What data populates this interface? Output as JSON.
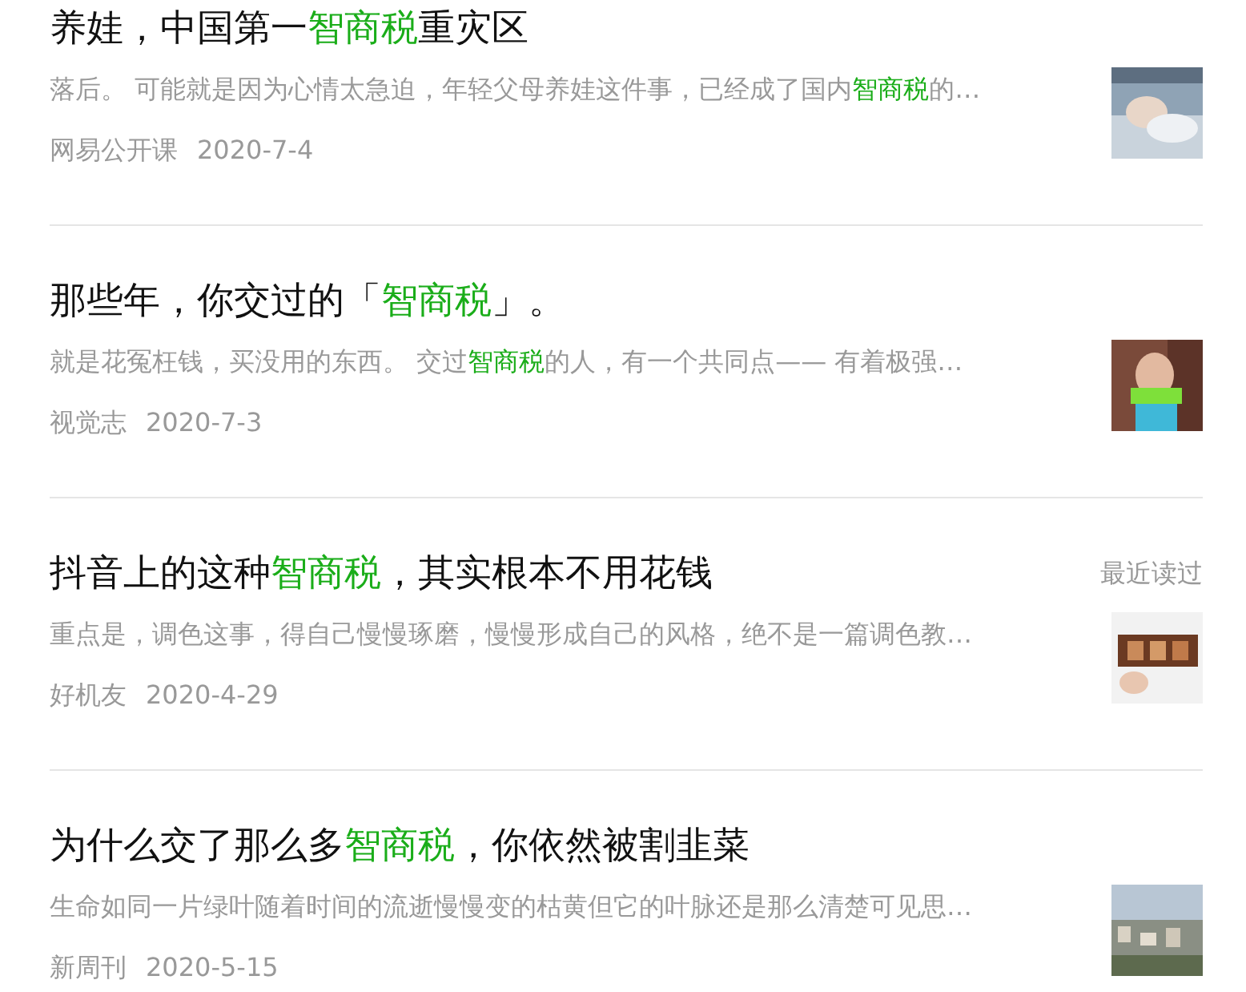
{
  "articles": [
    {
      "title": [
        {
          "text": "养娃，中国第一",
          "highlight": false
        },
        {
          "text": "智商税",
          "highlight": true
        },
        {
          "text": "重灾区",
          "highlight": false
        }
      ],
      "snippet": [
        {
          "text": "落后。 可能就是因为心情太急迫，年轻父母养娃这件事，已经成了国内",
          "highlight": false
        },
        {
          "text": "智商税",
          "highlight": true
        },
        {
          "text": "的…",
          "highlight": false
        }
      ],
      "source": "网易公开课",
      "date": "2020-7-4",
      "thumb": {
        "kind": "picture"
      }
    },
    {
      "title": [
        {
          "text": "那些年，你交过的「",
          "highlight": false
        },
        {
          "text": "智商税",
          "highlight": true
        },
        {
          "text": "」。",
          "highlight": false
        }
      ],
      "snippet": [
        {
          "text": "就是花冤枉钱，买没用的东西。 交过",
          "highlight": false
        },
        {
          "text": "智商税",
          "highlight": true
        },
        {
          "text": "的人，有一个共同点—— 有着极强…",
          "highlight": false
        }
      ],
      "source": "视觉志",
      "date": "2020-7-3",
      "thumb": {
        "kind": "picture"
      }
    },
    {
      "title": [
        {
          "text": "抖音上的这种",
          "highlight": false
        },
        {
          "text": "智商税",
          "highlight": true
        },
        {
          "text": "，其实根本不用花钱",
          "highlight": false
        }
      ],
      "recent": "最近读过",
      "snippet": [
        {
          "text": "重点是，调色这事，得自己慢慢琢磨，慢慢形成自己的风格，绝不是一篇调色教…",
          "highlight": false
        }
      ],
      "source": "好机友",
      "date": "2020-4-29",
      "thumb": {
        "kind": "picture"
      }
    },
    {
      "title": [
        {
          "text": "为什么交了那么多",
          "highlight": false
        },
        {
          "text": "智商税",
          "highlight": true
        },
        {
          "text": "，你依然被割韭菜",
          "highlight": false
        }
      ],
      "snippet": [
        {
          "text": "生命如同一片绿叶随着时间的流逝慢慢变的枯黄但它的叶脉还是那么清楚可见思…",
          "highlight": false
        }
      ],
      "source": "新周刊",
      "date": "2020-5-15",
      "thumb": {
        "kind": "picture"
      }
    }
  ]
}
